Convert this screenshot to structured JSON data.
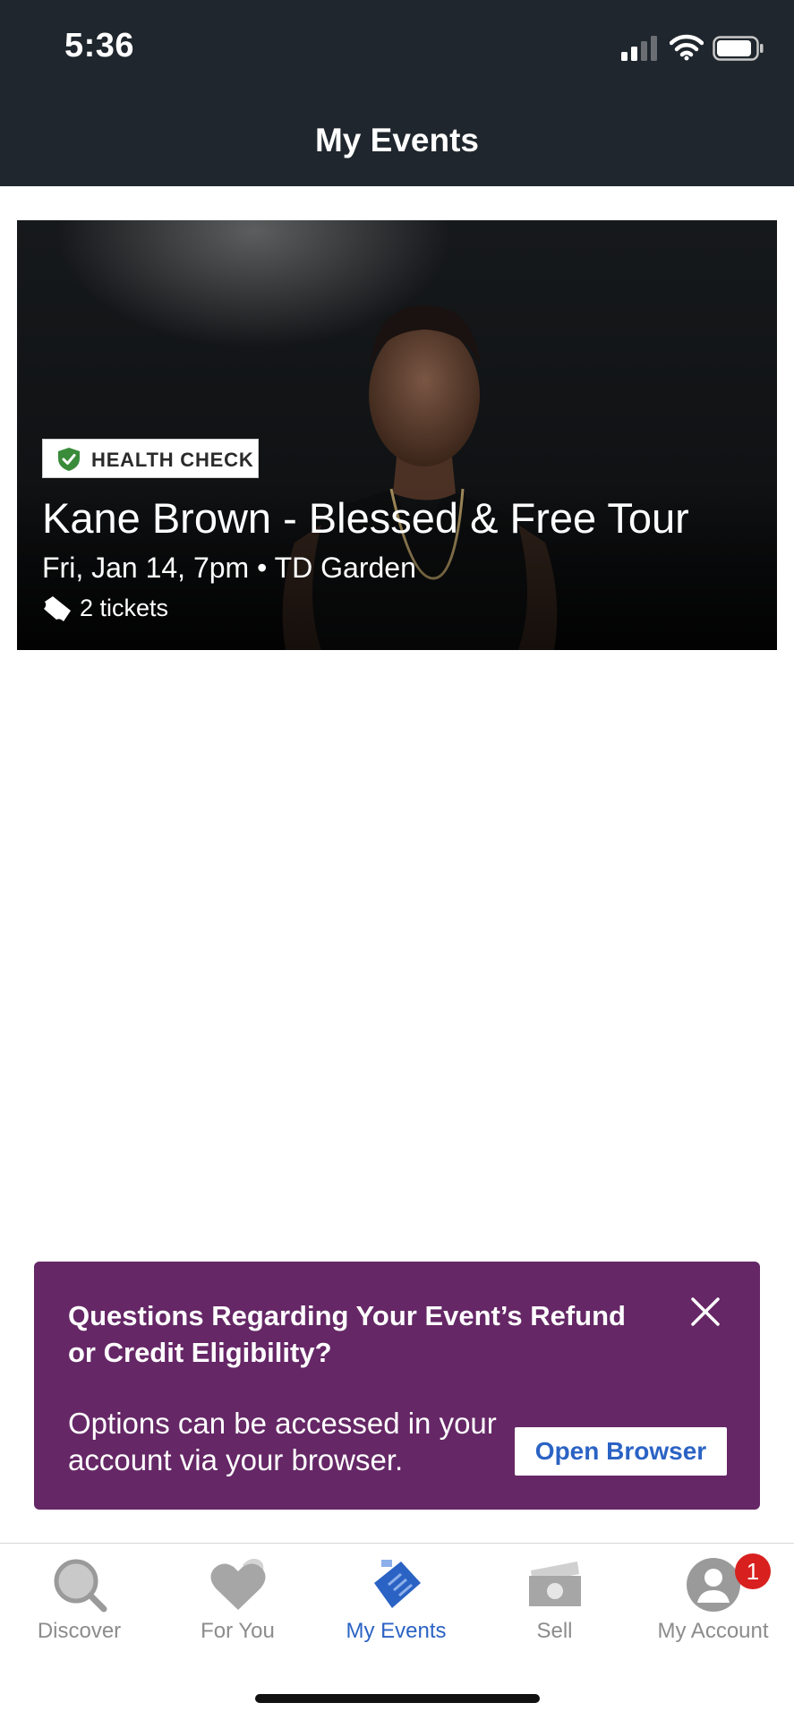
{
  "status_bar": {
    "time": "5:36"
  },
  "header": {
    "title": "My Events"
  },
  "event": {
    "badge": "HEALTH CHECK",
    "title": "Kane Brown - Blessed & Free Tour",
    "date_venue": "Fri, Jan 14, 7pm • TD Garden",
    "tickets": "2 tickets"
  },
  "banner": {
    "title": "Questions Regarding Your Event’s Refund or Credit Eligibility?",
    "body": "Options can be accessed in your account via your browser.",
    "button_label": "Open Browser"
  },
  "tabs": [
    {
      "label": "Discover",
      "icon": "search-icon",
      "active": false
    },
    {
      "label": "For You",
      "icon": "heart-icon",
      "active": false
    },
    {
      "label": "My Events",
      "icon": "tickets-icon",
      "active": true
    },
    {
      "label": "Sell",
      "icon": "money-icon",
      "active": false
    },
    {
      "label": "My Account",
      "icon": "person-icon",
      "active": false,
      "badge": "1"
    }
  ],
  "colors": {
    "header_bg": "#1f262d",
    "banner_bg": "#652766",
    "accent": "#2b63c4",
    "badge_red": "#d8201f",
    "health_green": "#3a8b3a"
  }
}
